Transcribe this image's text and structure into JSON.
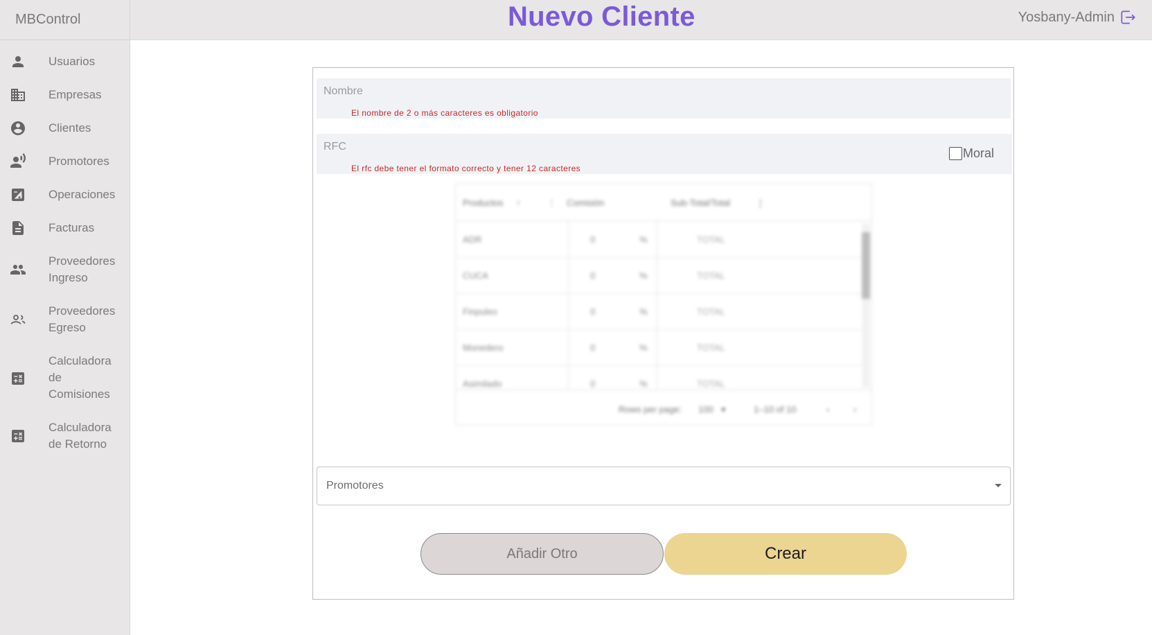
{
  "sidebar": {
    "brand": "MBControl",
    "items": [
      {
        "label": "Usuarios",
        "icon": "person-icon"
      },
      {
        "label": "Empresas",
        "icon": "building-icon"
      },
      {
        "label": "Clientes",
        "icon": "account-circle-icon"
      },
      {
        "label": "Promotores",
        "icon": "record-voice-icon"
      },
      {
        "label": "Operaciones",
        "icon": "calculate-square-icon"
      },
      {
        "label": "Facturas",
        "icon": "document-icon"
      },
      {
        "label": "Proveedores Ingreso",
        "icon": "people-icon"
      },
      {
        "label": "Proveedores Egreso",
        "icon": "people-outline-icon"
      },
      {
        "label": "Calculadora de Comisiones",
        "icon": "calculator-icon"
      },
      {
        "label": "Calculadora de Retorno",
        "icon": "calculator-icon"
      }
    ]
  },
  "header": {
    "title": "Nuevo Cliente",
    "user": "Yosbany-Admin",
    "logout_icon": "logout-icon",
    "accent": "#7b5ad8"
  },
  "form": {
    "nombre": {
      "placeholder": "Nombre",
      "error": "El nombre de 2 o más caracteres es obligatorio"
    },
    "rfc": {
      "placeholder": "RFC",
      "error": "El rfc debe tener el formato correcto y tener 12 caracteres"
    },
    "moral_label": "Moral",
    "grid": {
      "columns": [
        "Productos",
        "Comisión",
        "Sub-Total/Total"
      ],
      "rows": [
        {
          "producto": "ADR",
          "comision": "0",
          "unidad": "%",
          "tipo": "TOTAL"
        },
        {
          "producto": "CUCA",
          "comision": "0",
          "unidad": "%",
          "tipo": "TOTAL"
        },
        {
          "producto": "Finpuleo",
          "comision": "0",
          "unidad": "%",
          "tipo": "TOTAL"
        },
        {
          "producto": "Monedero",
          "comision": "0",
          "unidad": "%",
          "tipo": "TOTAL"
        },
        {
          "producto": "Asimilado",
          "comision": "0",
          "unidad": "%",
          "tipo": "TOTAL"
        }
      ],
      "rows_per_page_label": "Rows per page:",
      "rows_per_page": "100",
      "range": "1–10 of 10"
    },
    "promotores_placeholder": "Promotores",
    "add_button": "Añadir Otro",
    "create_button": "Crear",
    "create_color": "#ecd491"
  }
}
